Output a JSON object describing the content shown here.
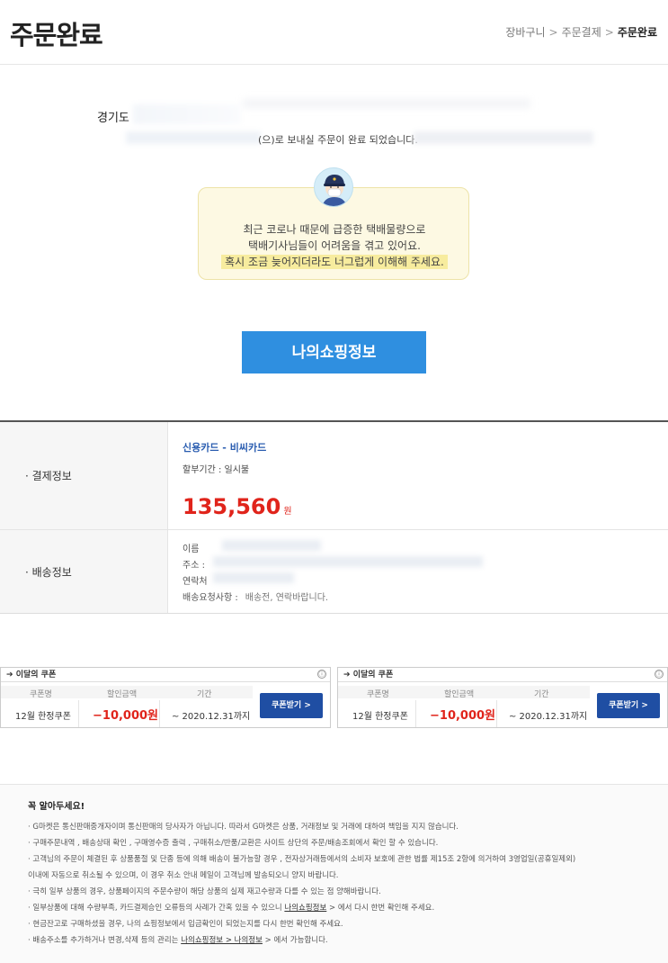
{
  "header": {
    "title": "주문완료",
    "breadcrumb": [
      "장바구니",
      "주문결제",
      "주문완료"
    ],
    "separator": ">"
  },
  "address": {
    "prefix": "경기도",
    "message": "(으)로 보내실 주문이 완료 되었습니다."
  },
  "notice": {
    "line1": "최근 코로나 때문에 급증한 택배물량으로",
    "line2": "택배기사님들이 어려움을 겪고 있어요.",
    "line3": "혹시 조금 늦어지더라도 너그럽게 이해해 주세요."
  },
  "myshop_button": "나의쇼핑정보",
  "payment": {
    "label": "·  결제정보",
    "card": "신용카드 - 비씨카드",
    "installment": "할부기간 : 일시불",
    "amount": "135,560",
    "unit": "원"
  },
  "shipping": {
    "label": "·  배송정보",
    "name_label": "이름",
    "address_label": "주소 :",
    "contact_label": "연락처",
    "memo_label": "배송요청사항 :",
    "memo_value": "배송전, 연락바랍니다."
  },
  "coupons": [
    {
      "title": "이달의 쿠폰",
      "info_icon": "ⓘ",
      "col_name": "쿠폰명",
      "col_discount": "할인금액",
      "col_period": "기간",
      "name": "12월 한정쿠폰",
      "discount": "−10,000원",
      "period": "~ 2020.12.31까지",
      "button": "쿠폰받기 >"
    },
    {
      "title": "이달의 쿠폰",
      "info_icon": "ⓘ",
      "col_name": "쿠폰명",
      "col_discount": "할인금액",
      "col_period": "기간",
      "name": "12월 한정쿠폰",
      "discount": "−10,000원",
      "period": "~ 2020.12.31까지",
      "button": "쿠폰받기 >"
    }
  ],
  "notes": {
    "title": "꼭 알아두세요!",
    "items": [
      "· G마켓은 통신판매중개자이며 통신판매의 당사자가 아닙니다. 따라서 G마켓은 상품, 거래정보 및 거래에 대하여 책임을 지지 않습니다.",
      "· 구매주문내역 , 배송상태 확인 , 구매영수증 출력 , 구매취소/반품/교환은 사이트 상단의 주문/배송조회에서 확인 할 수 있습니다.",
      "· 고객님의 주문이 체결된 후 상품품절 및 단종 등에 의해 배송이 불가능할 경우 , 전자상거래등에서의 소비자 보호에 관한 법률 제15조 2항에 의거하여 3영업일(공휴일제외)",
      "  이내에 자동으로 취소될 수 있으며, 이 경우 취소 안내 메일이 고객님께 발송되오니 양지 바랍니다.",
      "· 극히 일부 상품의 경우, 상품페이지의 주문수량이 해당 상품의 실제 재고수량과 다를 수 있는 점 양해바랍니다.",
      "· 일부상품에 대해 수량부족, 카드결제승인 오류등의 사례가 간혹 있을 수 있으니",
      "· 현금잔고로 구매하셨을 경우, 나의 쇼핑정보에서 입금확인이 되었는지를 다시 한번 확인해 주세요.",
      "· 배송주소를 추가하거나 변경,삭제 등의 관리는"
    ],
    "link1": "나의쇼핑정보",
    "link1_after": " > 에서 다시 한번 확인해 주세요.",
    "link2": "나의쇼핑정보 > 나의정보",
    "link2_after": " > 에서 가능합니다."
  }
}
